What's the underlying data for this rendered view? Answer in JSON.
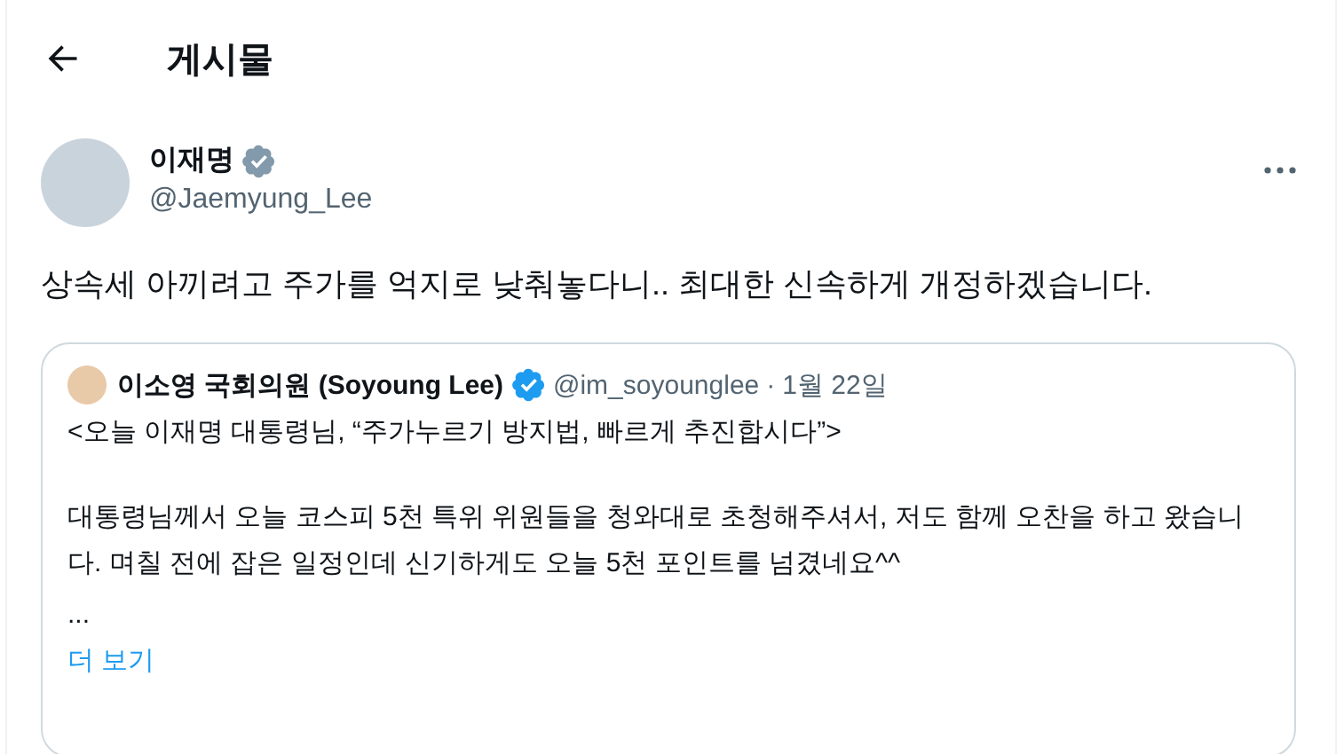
{
  "header": {
    "title": "게시물"
  },
  "post": {
    "author": {
      "name": "이재명",
      "handle": "@Jaemyung_Lee",
      "badge": {
        "kind": "government"
      }
    },
    "text": "상속세 아끼려고 주가를 억지로 낮춰놓다니.. 최대한 신속하게 개정하겠습니다.",
    "quote": {
      "author": {
        "name": "이소영 국회의원 (Soyoung Lee)",
        "handle": "@im_soyounglee",
        "separator": "·",
        "date": "1월 22일",
        "badge": {
          "kind": "blue"
        }
      },
      "paragraphs": [
        "<오늘 이재명 대통령님, “주가누르기 방지법, 빠르게 추진합시다”>",
        "대통령님께서 오늘 코스피 5천 특위 위원들을 청와대로 초청해주셔서, 저도 함께 오찬을 하고 왔습니다. 며칠 전에 잡은 일정인데 신기하게도 오늘 5천 포인트를 넘겼네요^^",
        "..."
      ],
      "show_more": "더 보기"
    }
  }
}
